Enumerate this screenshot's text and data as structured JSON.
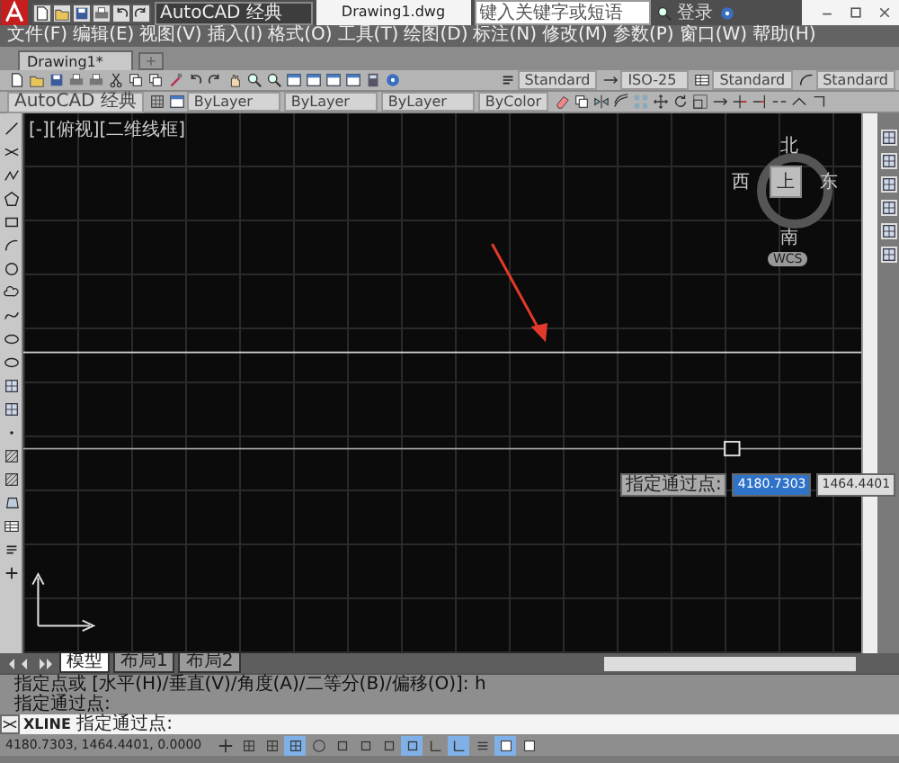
{
  "window": {
    "title": "Drawing1.dwg",
    "quick_access_workspace": "AutoCAD 经典",
    "search": {
      "placeholder": "键入关键字或短语"
    },
    "sign_in": "登录"
  },
  "menu": [
    "文件(F)",
    "编辑(E)",
    "视图(V)",
    "插入(I)",
    "格式(O)",
    "工具(T)",
    "绘图(D)",
    "标注(N)",
    "修改(M)",
    "参数(P)",
    "窗口(W)",
    "帮助(H)"
  ],
  "file_tabs": [
    {
      "label": "Drawing1*",
      "selected": true
    }
  ],
  "styles_toolbar": {
    "text_style": "Standard",
    "dimension_style": "ISO-25",
    "table_style": "Standard",
    "multileader_style": "Standard"
  },
  "properties_toolbar": {
    "workspace": "AutoCAD 经典",
    "layer": "ByLayer",
    "linetype": "ByLayer",
    "lineweight": "ByLayer",
    "plot_style": "ByColor"
  },
  "viewport": {
    "label": "[-][俯视][二维线框]",
    "viewcube": {
      "north": "北",
      "south": "南",
      "east": "东",
      "west": "西",
      "face": "上",
      "ucs": "WCS"
    },
    "tooltip": {
      "prompt": "指定通过点:",
      "x_value": "4180.7303",
      "y_value": "1464.4401"
    }
  },
  "layout_tabs": [
    {
      "label": "模型",
      "selected": true
    },
    {
      "label": "布局1",
      "selected": false
    },
    {
      "label": "布局2",
      "selected": false
    }
  ],
  "command_history": [
    "指定点或 [水平(H)/垂直(V)/角度(A)/二等分(B)/偏移(O)]: h",
    "指定通过点:"
  ],
  "command_line": {
    "command": "XLINE",
    "prompt": "指定通过点:"
  },
  "status_bar": {
    "coordinates": "4180.7303, 1464.4401, 0.0000",
    "toggles": [
      {
        "on": false
      },
      {
        "on": false
      },
      {
        "on": false
      },
      {
        "on": true
      },
      {
        "on": false
      },
      {
        "on": false
      },
      {
        "on": false
      },
      {
        "on": false
      },
      {
        "on": true
      },
      {
        "on": false
      },
      {
        "on": true
      },
      {
        "on": false
      },
      {
        "on": true
      },
      {
        "on": false
      }
    ]
  }
}
